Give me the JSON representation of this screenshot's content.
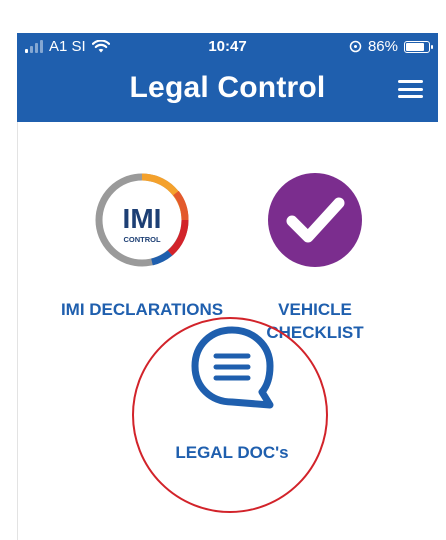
{
  "status_bar": {
    "carrier": "A1 SI",
    "time": "10:47",
    "battery": "86%",
    "battery_level": 0.86
  },
  "header": {
    "title": "Legal Control"
  },
  "tiles": [
    {
      "label": "IMI DECLARATIONS",
      "icon": "imi-control-logo",
      "logo_text": "IMI",
      "logo_subtext": "CONTROL"
    },
    {
      "label": "VEHICLE CHECKLIST",
      "label_line1": "VEHICLE",
      "label_line2": "CHECKLIST",
      "icon": "checkmark-icon"
    },
    {
      "label": "LEGAL DOC's",
      "icon": "chat-bubble-icon"
    }
  ],
  "colors": {
    "brand_blue": "#1f5fae",
    "checklist_purple": "#7b2d8e",
    "highlight_red": "#d2232a"
  }
}
